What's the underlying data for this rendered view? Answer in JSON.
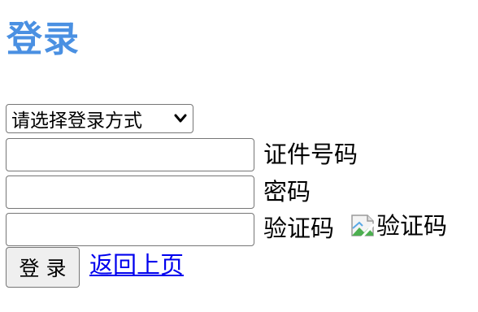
{
  "page": {
    "title": "登录",
    "title_color": "#4a90e2"
  },
  "form": {
    "method_select": {
      "selected": "请选择登录方式",
      "icon": "chevron-down-icon"
    },
    "id_number": {
      "value": "",
      "label": "证件号码"
    },
    "password": {
      "value": "",
      "label": "密码"
    },
    "captcha": {
      "value": "",
      "label": "验证码",
      "image_alt": "验证码",
      "image_icon": "broken-image-icon"
    },
    "submit_label": "登 录",
    "back_link": "返回上页",
    "link_color": "#0000ee"
  }
}
